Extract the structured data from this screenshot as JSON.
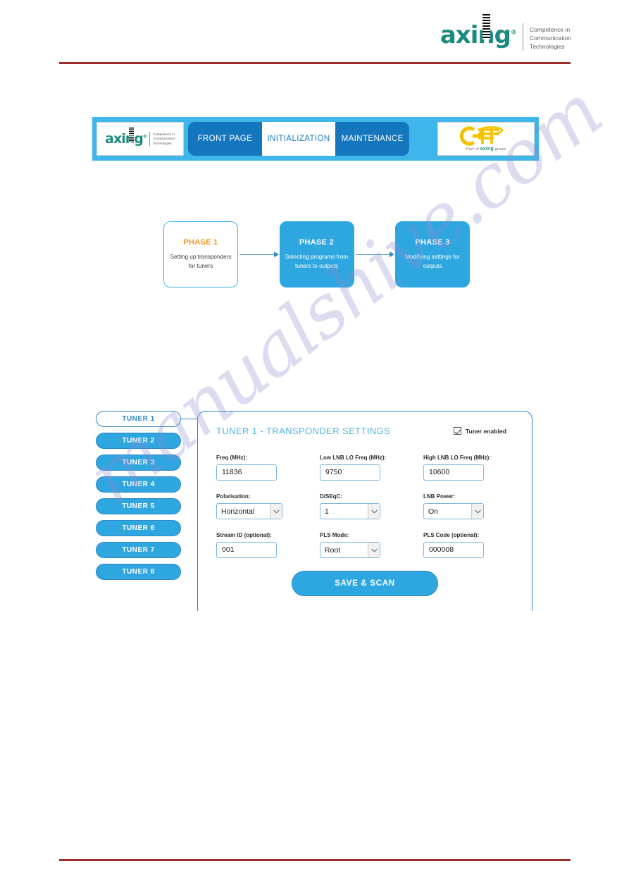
{
  "document": {
    "brand_name": "axing",
    "brand_registered": "®",
    "brand_tagline_line1": "Competence in",
    "brand_tagline_line2": "Communication",
    "brand_tagline_line3": "Technologies",
    "watermark": "manualshive.com",
    "rule_color": "#9e2a2b"
  },
  "navbar": {
    "logo_name": "axing",
    "logo_tagline_line1": "Competence in",
    "logo_tagline_line2": "Communication",
    "logo_tagline_line3": "Technologies",
    "tabs": [
      {
        "label": "FRONT PAGE",
        "active": false
      },
      {
        "label": "INITIALIZATION",
        "active": true
      },
      {
        "label": "MAINTENANCE",
        "active": false
      }
    ],
    "rf_logo": {
      "mark": "RF",
      "caption_prefix": "Part of ",
      "caption_brand": "axing",
      "caption_suffix": " group"
    },
    "colors": {
      "bar": "#3fb6ea",
      "tab": "#1477be",
      "active_tab_text": "#1d7ec2"
    }
  },
  "phases": [
    {
      "title": "PHASE 1",
      "description": "Setting up transponders for tuners",
      "style": "white",
      "title_color": "#f0921e"
    },
    {
      "title": "PHASE 2",
      "description": "Selecting programs from tuners to outputs",
      "style": "blue",
      "title_color": "#ffffff"
    },
    {
      "title": "PHASE 3",
      "description": "Modifying settings for outputs",
      "style": "blue",
      "title_color": "#ffffff"
    }
  ],
  "tuner_tabs": [
    {
      "label": "TUNER 1",
      "active": true
    },
    {
      "label": "TUNER 2",
      "active": false
    },
    {
      "label": "TUNER 3",
      "active": false
    },
    {
      "label": "TUNER 4",
      "active": false
    },
    {
      "label": "TUNER 5",
      "active": false
    },
    {
      "label": "TUNER 6",
      "active": false
    },
    {
      "label": "TUNER 7",
      "active": false
    },
    {
      "label": "TUNER 8",
      "active": false
    }
  ],
  "panel": {
    "title": "TUNER 1 - TRANSPONDER SETTINGS",
    "enable_label": "Tuner enabled",
    "enable_checked": true,
    "accent_color": "#55b4e6",
    "fields": {
      "freq": {
        "label": "Freq (MHz):",
        "value": "11836"
      },
      "low_lnb": {
        "label": "Low LNB LO Freq (MHz):",
        "value": "9750"
      },
      "high_lnb": {
        "label": "High LNB LO Freq (MHz):",
        "value": "10600"
      },
      "polarisation": {
        "label": "Polarisation:",
        "value": "Horizontal"
      },
      "diseqc": {
        "label": "DiSEqC:",
        "value": "1"
      },
      "lnb_power": {
        "label": "LNB Power:",
        "value": "On"
      },
      "stream_id": {
        "label": "Stream ID (optional):",
        "value": "001"
      },
      "pls_mode": {
        "label": "PLS Mode:",
        "value": "Root"
      },
      "pls_code": {
        "label": "PLS Code (optional):",
        "value": "000008"
      }
    },
    "save_button": "SAVE & SCAN"
  }
}
